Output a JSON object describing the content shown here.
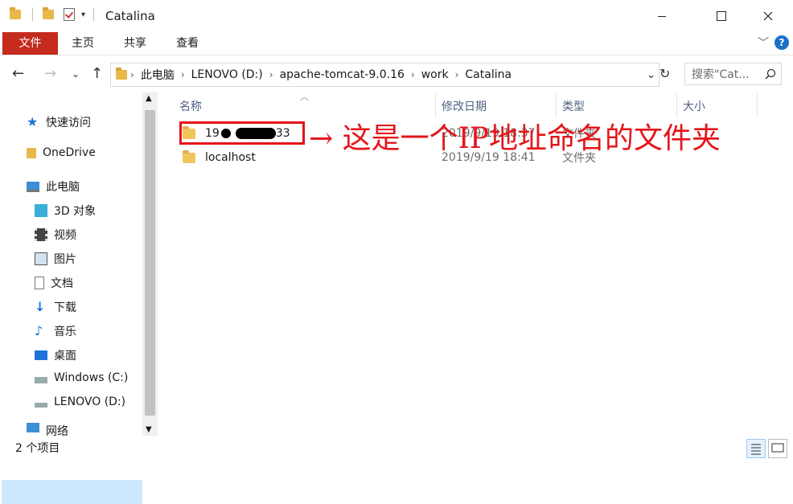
{
  "window": {
    "title": "Catalina"
  },
  "ribbon": {
    "tabs": [
      "文件",
      "主页",
      "共享",
      "查看"
    ],
    "help": "?"
  },
  "address": {
    "crumbs": [
      "此电脑",
      "LENOVO (D:)",
      "apache-tomcat-9.0.16",
      "work",
      "Catalina"
    ],
    "search_placeholder": "搜索\"Cat..."
  },
  "sidebar": {
    "quick_access": "快速访问",
    "onedrive": "OneDrive",
    "this_pc": "此电脑",
    "items": [
      "3D 对象",
      "视频",
      "图片",
      "文档",
      "下载",
      "音乐",
      "桌面",
      "Windows (C:)",
      "LENOVO (D:)"
    ],
    "network": "网络"
  },
  "columns": {
    "name": "名称",
    "date": "修改日期",
    "type": "类型",
    "size": "大小"
  },
  "files": [
    {
      "name_prefix": "19",
      "name_suffix": "33",
      "date": "2019/9/19 18:37",
      "type": "文件夹"
    },
    {
      "name": "localhost",
      "date": "2019/9/19 18:41",
      "type": "文件夹"
    }
  ],
  "status": {
    "count": "2 个项目"
  },
  "annotation": {
    "text": "→ 这是一个IP地址命名的文件夹"
  },
  "colors": {
    "accent_red": "#e5141a",
    "file_tab": "#c42b1c",
    "selection": "#cce8ff"
  }
}
